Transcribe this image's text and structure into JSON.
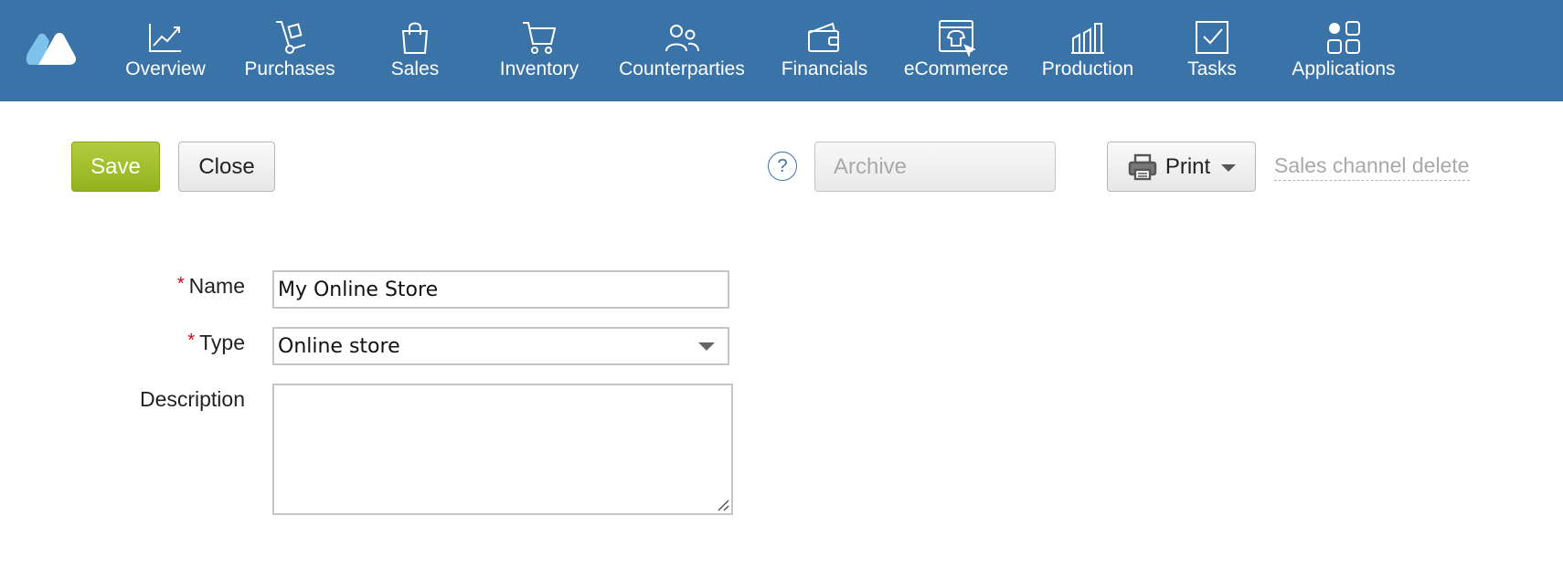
{
  "nav": {
    "logo_icon": "app-logo",
    "items": [
      {
        "label": "Overview",
        "icon": "chart-line-icon"
      },
      {
        "label": "Purchases",
        "icon": "hand-truck-icon"
      },
      {
        "label": "Sales",
        "icon": "shopping-bag-icon"
      },
      {
        "label": "Inventory",
        "icon": "cart-icon"
      },
      {
        "label": "Counterparties",
        "icon": "people-icon"
      },
      {
        "label": "Financials",
        "icon": "wallet-icon"
      },
      {
        "label": "eCommerce",
        "icon": "storefront-icon"
      },
      {
        "label": "Production",
        "icon": "factory-icon"
      },
      {
        "label": "Tasks",
        "icon": "checkbox-icon"
      },
      {
        "label": "Applications",
        "icon": "apps-grid-icon"
      }
    ]
  },
  "toolbar": {
    "save_label": "Save",
    "close_label": "Close",
    "help_label": "?",
    "archive_label": "Archive",
    "print_label": "Print",
    "delete_label": "Sales channel delete"
  },
  "form": {
    "required_mark": "*",
    "name_label": "Name",
    "name_value": "My Online Store",
    "type_label": "Type",
    "type_value": "Online store",
    "description_label": "Description",
    "description_value": ""
  },
  "colors": {
    "topbar": "#3a73a7",
    "save_button": "#a3bf2c",
    "required": "#d0021b"
  }
}
